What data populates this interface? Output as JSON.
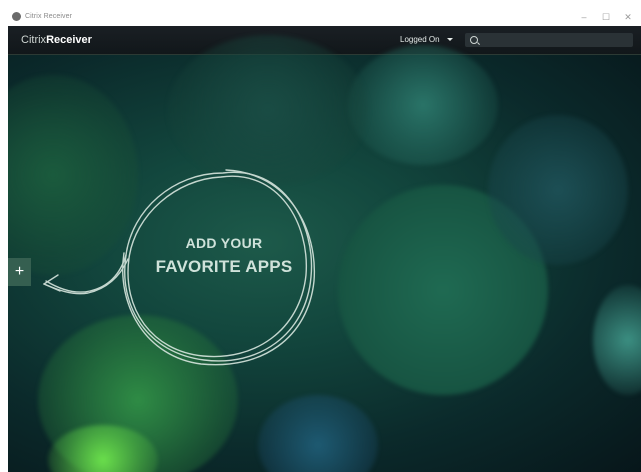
{
  "window": {
    "title": "Citrix Receiver",
    "controls": {
      "minimize": "–",
      "maximize": "☐",
      "close": "✕"
    }
  },
  "appbar": {
    "brand_light": "Citrix",
    "brand_bold": "Receiver",
    "user_menu_label": "Logged On",
    "search_value": "",
    "search_placeholder": ""
  },
  "main": {
    "add_button_label": "+",
    "prompt_line1": "ADD YOUR",
    "prompt_line2": "FAVORITE APPS"
  },
  "colors": {
    "appbar_bg": "#161c20",
    "accent_green": "#355f50",
    "background_teal": "#12463d"
  }
}
